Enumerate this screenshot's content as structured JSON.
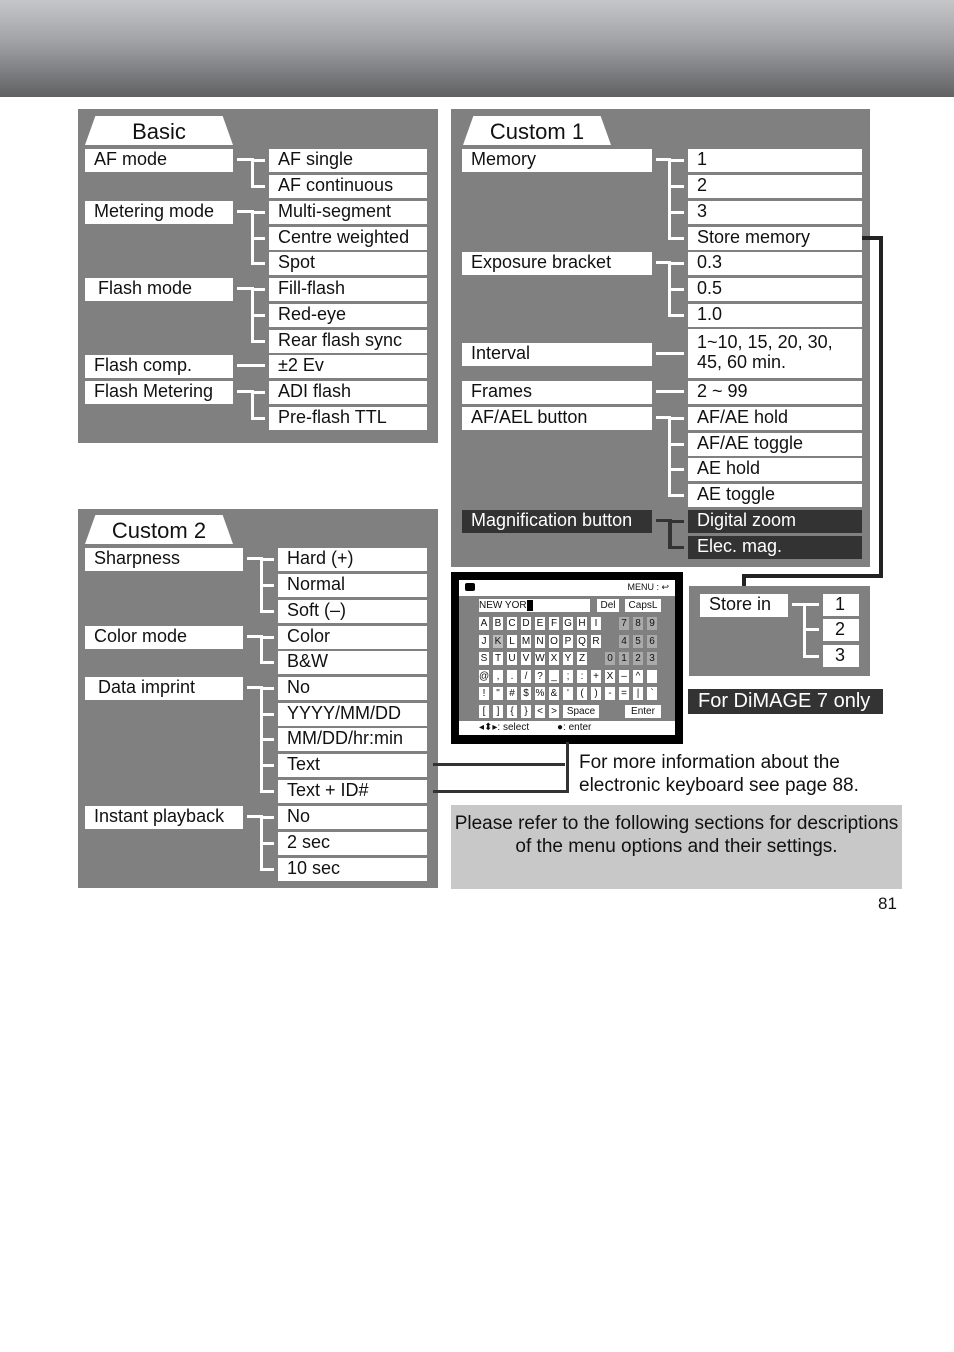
{
  "page_number": "81",
  "basic": {
    "title": "Basic",
    "groups": [
      {
        "label": "AF mode",
        "options": [
          "AF single",
          "AF continuous"
        ]
      },
      {
        "label": "Metering mode",
        "options": [
          "Multi-segment",
          "Centre weighted",
          "Spot"
        ]
      },
      {
        "label": "Flash mode",
        "options": [
          "Fill-flash",
          "Red-eye",
          "Rear flash sync"
        ]
      },
      {
        "label": "Flash comp.",
        "options": [
          "±2 Ev"
        ]
      },
      {
        "label": "Flash Metering",
        "options": [
          "ADI flash",
          "Pre-flash TTL"
        ]
      }
    ]
  },
  "custom1": {
    "title": "Custom 1",
    "groups": [
      {
        "label": "Memory",
        "options": [
          "1",
          "2",
          "3",
          "Store memory"
        ]
      },
      {
        "label": "Exposure bracket",
        "options": [
          "0.3",
          "0.5",
          "1.0"
        ]
      },
      {
        "label": "Interval",
        "options": [
          "1~10, 15, 20, 30, 45, 60 min."
        ]
      },
      {
        "label": "Frames",
        "options": [
          "2 ~ 99"
        ]
      },
      {
        "label": "AF/AEL button",
        "options": [
          "AF/AE hold",
          "AF/AE toggle",
          "AE hold",
          "AE toggle"
        ]
      },
      {
        "label": "Magnification button",
        "options": [
          "Digital zoom",
          "Elec. mag."
        ]
      }
    ]
  },
  "store_in": {
    "label": "Store in",
    "options": [
      "1",
      "2",
      "3"
    ]
  },
  "dimage7_note": "For DiMAGE 7 only",
  "custom2": {
    "title": "Custom 2",
    "groups": [
      {
        "label": "Sharpness",
        "options": [
          "Hard (+)",
          "Normal",
          "Soft (–)"
        ]
      },
      {
        "label": "Color mode",
        "options": [
          "Color",
          "B&W"
        ]
      },
      {
        "label": "Data imprint",
        "options": [
          "No",
          "YYYY/MM/DD",
          "MM/DD/hr:min",
          "Text",
          "Text + ID#"
        ]
      },
      {
        "label": "Instant playback",
        "options": [
          "No",
          "2 sec",
          "10 sec"
        ]
      }
    ]
  },
  "keyboard": {
    "menu_hint": "MENU : ↩",
    "text_value": "NEW YOR",
    "del": "Del",
    "caps": "CapsL",
    "space": "Space",
    "enter": "Enter",
    "footer_select": "◂⬍▸: select",
    "footer_enter": "●: enter",
    "rows": [
      [
        "A",
        "B",
        "C",
        "D",
        "E",
        "F",
        "G",
        "H",
        "I",
        "",
        "7",
        "8",
        "9"
      ],
      [
        "J",
        "K",
        "L",
        "M",
        "N",
        "O",
        "P",
        "Q",
        "R",
        "",
        "4",
        "5",
        "6"
      ],
      [
        "S",
        "T",
        "U",
        "V",
        "W",
        "X",
        "Y",
        "Z",
        "",
        "0",
        "1",
        "2",
        "3"
      ],
      [
        "@",
        ",",
        ".",
        "/",
        "?",
        "_",
        ";",
        ":",
        "+",
        "X",
        "–",
        "^",
        " "
      ],
      [
        "!",
        "\"",
        "#",
        "$",
        "%",
        "&",
        "'",
        "(",
        ")",
        "-",
        "=",
        "|",
        "`"
      ],
      [
        "[",
        "]",
        "{",
        "}",
        "<",
        ">"
      ]
    ]
  },
  "keyboard_note": "For more information about the electronic keyboard see page 88.",
  "refer_note": "Please refer to the following sections for descriptions of the menu options and their settings."
}
